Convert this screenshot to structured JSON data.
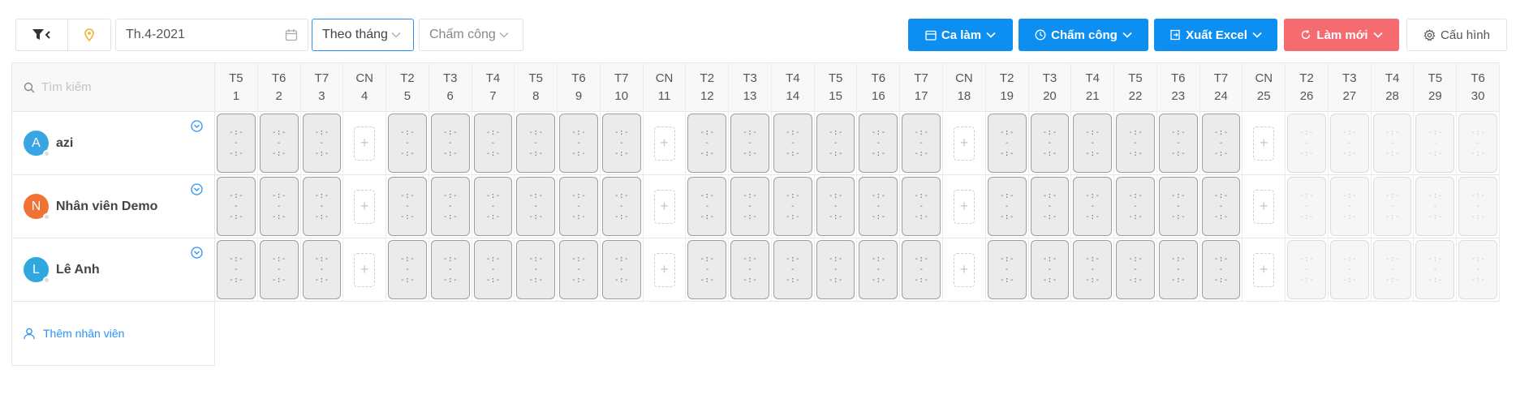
{
  "toolbar": {
    "month_value": "Th.4-2021",
    "view_value": "Theo tháng",
    "mode_value": "Chấm công",
    "ca_lam_label": "Ca làm",
    "cham_cong_label": "Chấm công",
    "xuat_excel_label": "Xuất Excel",
    "lam_moi_label": "Làm mới",
    "cau_hinh_label": "Cấu hình",
    "accent_color": "#0d8ff2",
    "refresh_color": "#f56b6f"
  },
  "search": {
    "placeholder": "Tìm kiếm"
  },
  "days": [
    {
      "wd": "T5",
      "d": "1"
    },
    {
      "wd": "T6",
      "d": "2"
    },
    {
      "wd": "T7",
      "d": "3"
    },
    {
      "wd": "CN",
      "d": "4"
    },
    {
      "wd": "T2",
      "d": "5"
    },
    {
      "wd": "T3",
      "d": "6"
    },
    {
      "wd": "T4",
      "d": "7"
    },
    {
      "wd": "T5",
      "d": "8"
    },
    {
      "wd": "T6",
      "d": "9"
    },
    {
      "wd": "T7",
      "d": "10"
    },
    {
      "wd": "CN",
      "d": "11"
    },
    {
      "wd": "T2",
      "d": "12"
    },
    {
      "wd": "T3",
      "d": "13"
    },
    {
      "wd": "T4",
      "d": "14"
    },
    {
      "wd": "T5",
      "d": "15"
    },
    {
      "wd": "T6",
      "d": "16"
    },
    {
      "wd": "T7",
      "d": "17"
    },
    {
      "wd": "CN",
      "d": "18"
    },
    {
      "wd": "T2",
      "d": "19"
    },
    {
      "wd": "T3",
      "d": "20"
    },
    {
      "wd": "T4",
      "d": "21"
    },
    {
      "wd": "T5",
      "d": "22"
    },
    {
      "wd": "T6",
      "d": "23"
    },
    {
      "wd": "T7",
      "d": "24"
    },
    {
      "wd": "CN",
      "d": "25"
    },
    {
      "wd": "T2",
      "d": "26"
    },
    {
      "wd": "T3",
      "d": "27"
    },
    {
      "wd": "T4",
      "d": "28"
    },
    {
      "wd": "T5",
      "d": "29"
    },
    {
      "wd": "T6",
      "d": "30"
    }
  ],
  "shift_lines": [
    "-:-",
    "-",
    "-:-"
  ],
  "plus_symbol": "+",
  "employees": [
    {
      "initial": "A",
      "name": "azi",
      "color": "#39a6e3"
    },
    {
      "initial": "N",
      "name": "Nhân viên Demo",
      "color": "#f07234"
    },
    {
      "initial": "L",
      "name": "Lê Anh",
      "color": "#2fa7df"
    }
  ],
  "add_employee_label": "Thêm nhân viên"
}
